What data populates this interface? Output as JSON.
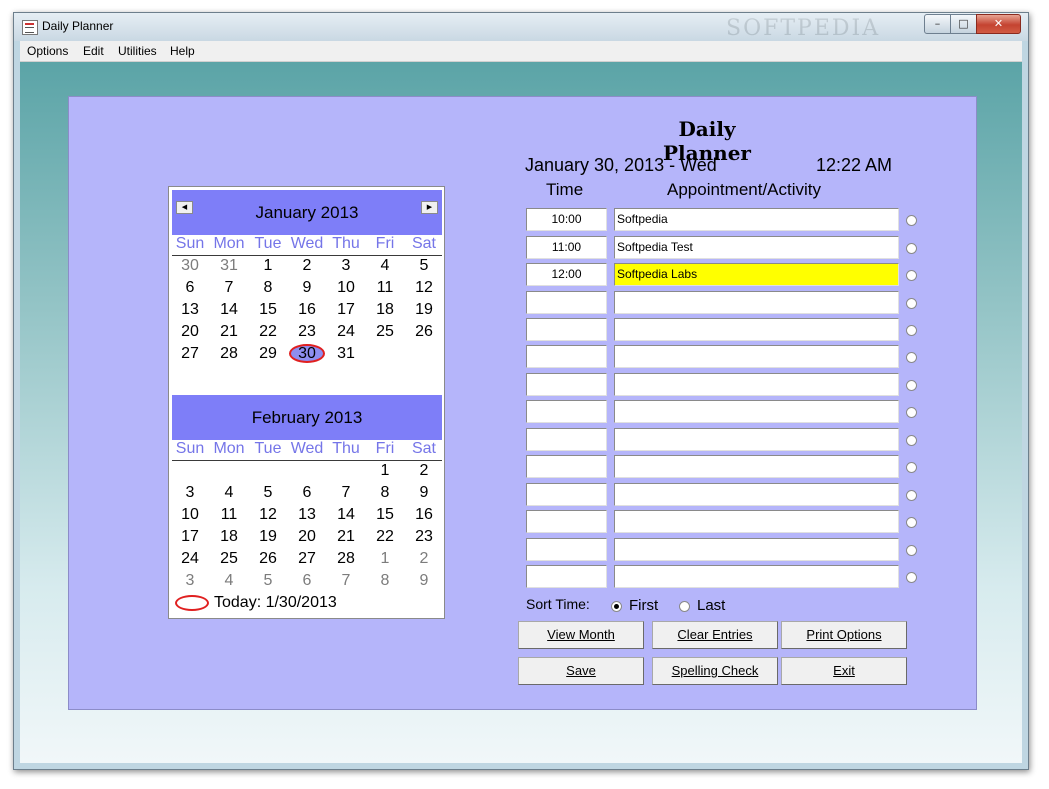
{
  "window": {
    "title": "Daily Planner",
    "watermark": "SOFTPEDIA"
  },
  "menu": [
    "Options",
    "Edit",
    "Utilities",
    "Help"
  ],
  "planner": {
    "title": "Daily Planner",
    "date": "January 30, 2013 - Wed",
    "time": "12:22 AM",
    "col_time": "Time",
    "col_appt": "Appointment/Activity"
  },
  "appointments": [
    {
      "time": "10:00",
      "activity": "Softpedia"
    },
    {
      "time": "11:00",
      "activity": "Softpedia Test"
    },
    {
      "time": "12:00",
      "activity": "Softpedia Labs"
    },
    {
      "time": "",
      "activity": ""
    },
    {
      "time": "",
      "activity": ""
    },
    {
      "time": "",
      "activity": ""
    },
    {
      "time": "",
      "activity": ""
    },
    {
      "time": "",
      "activity": ""
    },
    {
      "time": "",
      "activity": ""
    },
    {
      "time": "",
      "activity": ""
    },
    {
      "time": "",
      "activity": ""
    },
    {
      "time": "",
      "activity": ""
    },
    {
      "time": "",
      "activity": ""
    },
    {
      "time": "",
      "activity": ""
    }
  ],
  "active_row": 2,
  "sort": {
    "label": "Sort Time:",
    "first": "First",
    "last": "Last",
    "selected": "First"
  },
  "buttons": {
    "view_month": "View Month",
    "clear_entries": "Clear Entries",
    "print_options": "Print Options",
    "save": "Save",
    "spelling_check": "Spelling Check",
    "exit": "Exit"
  },
  "calendar": {
    "weekdays": [
      "Sun",
      "Mon",
      "Tue",
      "Wed",
      "Thu",
      "Fri",
      "Sat"
    ],
    "months": [
      {
        "title": "January 2013",
        "weeks": [
          [
            "30",
            "31",
            "1",
            "2",
            "3",
            "4",
            "5"
          ],
          [
            "6",
            "7",
            "8",
            "9",
            "10",
            "11",
            "12"
          ],
          [
            "13",
            "14",
            "15",
            "16",
            "17",
            "18",
            "19"
          ],
          [
            "20",
            "21",
            "22",
            "23",
            "24",
            "25",
            "26"
          ],
          [
            "27",
            "28",
            "29",
            "30",
            "31",
            "",
            ""
          ]
        ],
        "other_month": [
          [
            0,
            0
          ],
          [
            0,
            1
          ]
        ]
      },
      {
        "title": "February 2013",
        "weeks": [
          [
            "",
            "",
            "",
            "",
            "",
            "1",
            "2"
          ],
          [
            "3",
            "4",
            "5",
            "6",
            "7",
            "8",
            "9"
          ],
          [
            "10",
            "11",
            "12",
            "13",
            "14",
            "15",
            "16"
          ],
          [
            "17",
            "18",
            "19",
            "20",
            "21",
            "22",
            "23"
          ],
          [
            "24",
            "25",
            "26",
            "27",
            "28",
            "1",
            "2"
          ],
          [
            "3",
            "4",
            "5",
            "6",
            "7",
            "8",
            "9"
          ]
        ],
        "other_month": [
          [
            4,
            5
          ],
          [
            4,
            6
          ],
          [
            5,
            0
          ],
          [
            5,
            1
          ],
          [
            5,
            2
          ],
          [
            5,
            3
          ],
          [
            5,
            4
          ],
          [
            5,
            5
          ],
          [
            5,
            6
          ]
        ]
      }
    ],
    "selected_day": "30",
    "today_label": "Today: 1/30/2013"
  },
  "colors": {
    "panel": "#b5b5fa",
    "month_header": "#7e7ef8",
    "weekday_text": "#7575e8",
    "active_entry": "#ffff00",
    "selection_ring": "#e02020"
  }
}
